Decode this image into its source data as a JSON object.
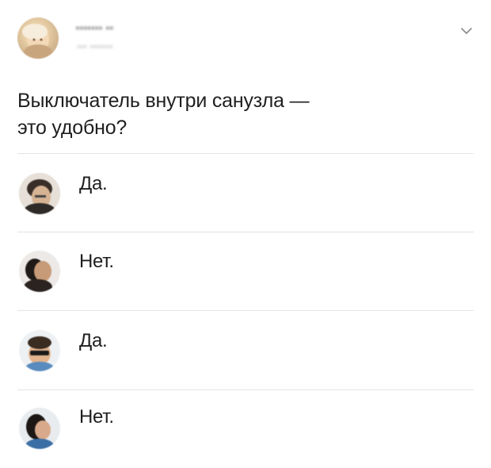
{
  "post": {
    "author_name": "••••••• ••",
    "author_meta": "•••  •••••••",
    "question_line1": "Выключатель внутри санузла —",
    "question_line2": "это удобно?"
  },
  "replies": [
    {
      "text": "Да.",
      "avatar": "avatar-person-1"
    },
    {
      "text": "Нет.",
      "avatar": "avatar-person-2"
    },
    {
      "text": "Да.",
      "avatar": "avatar-person-3"
    },
    {
      "text": "Нет.",
      "avatar": "avatar-person-4"
    }
  ],
  "icons": {
    "menu": "chevron-down-icon"
  },
  "colors": {
    "text": "#1f1f1f",
    "divider": "#e3e3e3",
    "chevron": "#8a8a8a"
  }
}
